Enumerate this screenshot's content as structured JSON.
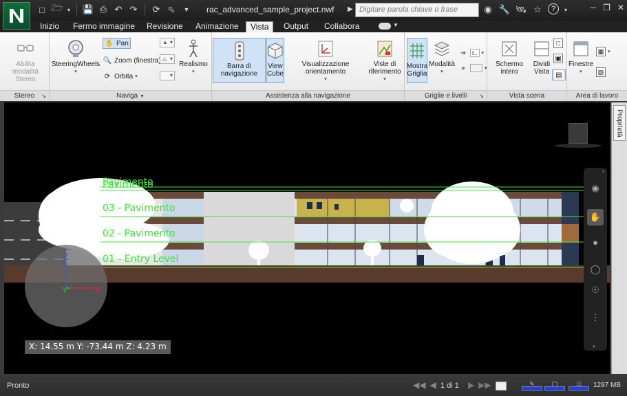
{
  "titlebar": {
    "document_title": "rac_advanced_sample_project.nwf",
    "search_placeholder": "Digitare parola chiave o frase",
    "quick_access": [
      "new-file-icon",
      "open-folder-icon",
      "save-icon",
      "print-icon",
      "undo-icon",
      "redo-icon",
      "refresh-icon",
      "select-arrow-icon"
    ],
    "right_tools": [
      "binoculars-icon",
      "wrench-icon",
      "satellite-icon",
      "star-icon",
      "help-icon"
    ]
  },
  "tabs": [
    {
      "label": "Inizio",
      "active": false
    },
    {
      "label": "Fermo immagine",
      "active": false
    },
    {
      "label": "Revisione",
      "active": false
    },
    {
      "label": "Animazione",
      "active": false
    },
    {
      "label": "Vista",
      "active": true
    },
    {
      "label": "Output",
      "active": false
    },
    {
      "label": "Collabora",
      "active": false
    }
  ],
  "ribbon": {
    "stereo": {
      "button": "Abilita modalità Stereo",
      "title": "Stereo"
    },
    "naviga": {
      "steering": "SteeringWheels",
      "pan": "Pan",
      "zoom": "Zoom (finestra)",
      "orbit": "Orbita",
      "realism": "Realismo",
      "title": "Naviga"
    },
    "assist": {
      "navbar": "Barra di navigazione",
      "viewcube": "View Cube",
      "orient": "Visualizzazione orientamento",
      "refviews": "Viste di riferimento",
      "title": "Assistenza alla navigazione"
    },
    "grids": {
      "show_grid": "Mostra Griglia",
      "mode": "Modalità",
      "combo": "r..",
      "title": "Griglie e livelli"
    },
    "scene": {
      "fullscreen": "Schermo intero",
      "split": "Dividi Vista",
      "title": "Vista scena"
    },
    "workspace": {
      "windows": "Finestre",
      "title": "Area di lavoro"
    }
  },
  "viewport": {
    "levels": [
      {
        "label": "Pavimento"
      },
      {
        "label": "Pavimento"
      },
      {
        "label": "03 - Pavimento"
      },
      {
        "label": "02 - Pavimento"
      },
      {
        "label": "01 - Entry Level"
      }
    ],
    "coordinates": "X: 14.55 m  Y: -73.44 m  Z: 4.23 m",
    "gizmo": {
      "x": "X",
      "y": "Y",
      "z": "Z"
    }
  },
  "sidepanel": {
    "tab": "Proprietà"
  },
  "statusbar": {
    "status": "Pronto",
    "page": "1 di 1",
    "memory": "1297 MB"
  },
  "colors": {
    "level_line": "#39e639",
    "selected_button": "#cfe2f6",
    "app_green": "#0d6f3a"
  }
}
